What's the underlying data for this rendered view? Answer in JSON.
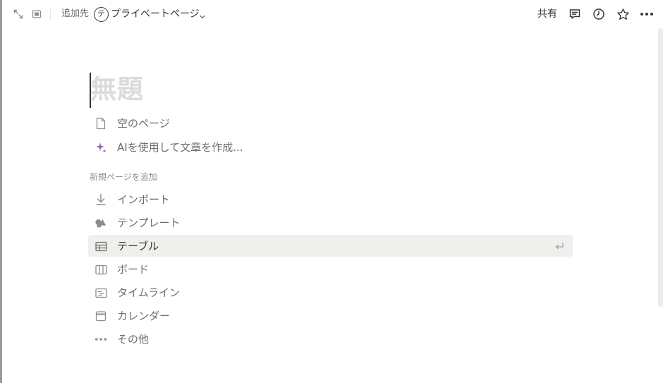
{
  "topbar": {
    "left_icons": [
      "expand-arrows-icon",
      "side-peek-icon"
    ],
    "breadcrumb_prefix": "追加先",
    "workspace_avatar_letter": "テ",
    "page_location": "プライベートページ",
    "share_label": "共有",
    "right_icons": [
      "comment-icon",
      "history-clock-icon",
      "star-icon",
      "more-horizontal-icon"
    ]
  },
  "page": {
    "title_placeholder": "無題"
  },
  "quick_actions": [
    {
      "icon": "blank-page-icon",
      "label": "空のページ"
    },
    {
      "icon": "ai-sparkle-icon",
      "label": "AIを使用して文章を作成..."
    }
  ],
  "section_label": "新規ページを追加",
  "add_options": [
    {
      "icon": "import-arrow-icon",
      "label": "インポート",
      "selected": false
    },
    {
      "icon": "template-shapes-icon",
      "label": "テンプレート",
      "selected": false
    },
    {
      "icon": "table-icon",
      "label": "テーブル",
      "selected": true
    },
    {
      "icon": "board-icon",
      "label": "ボード",
      "selected": false
    },
    {
      "icon": "timeline-icon",
      "label": "タイムライン",
      "selected": false
    },
    {
      "icon": "calendar-icon",
      "label": "カレンダー",
      "selected": false
    },
    {
      "icon": "more-dots-icon",
      "label": "その他",
      "selected": false
    }
  ],
  "colors": {
    "text": "#37352f",
    "muted": "#6f6e69",
    "title_placeholder": "#dcdbd9",
    "hover_bg": "#efefed",
    "ai_accent": "#9065b0"
  }
}
